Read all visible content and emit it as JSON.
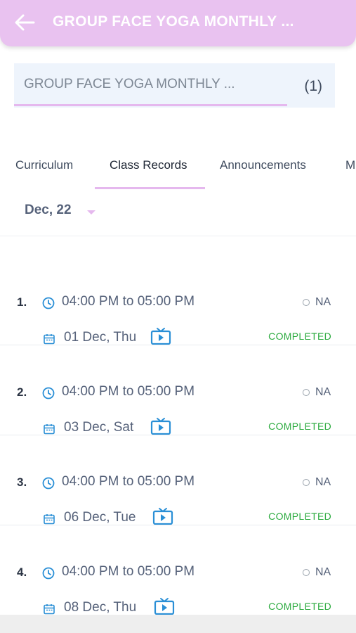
{
  "header": {
    "title": "GROUP FACE YOGA MONTHLY ...",
    "back_icon": "arrow-left-icon",
    "background": "#e9c2f0"
  },
  "course": {
    "name": "GROUP FACE YOGA MONTHLY ...",
    "count": "(1)"
  },
  "tabs": [
    {
      "label": "Curriculum",
      "active": false
    },
    {
      "label": "Class Records",
      "active": true
    },
    {
      "label": "Announcements",
      "active": false
    },
    {
      "label": "M",
      "active": false
    }
  ],
  "month_selector": {
    "label": "Dec, 22",
    "icon": "caret-down-icon"
  },
  "records": [
    {
      "number": "1.",
      "time": "04:00 PM to 05:00 PM",
      "na": "NA",
      "date": "01 Dec, Thu",
      "status": "COMPLETED"
    },
    {
      "number": "2.",
      "time": "04:00 PM to 05:00 PM",
      "na": "NA",
      "date": "03 Dec, Sat",
      "status": "COMPLETED"
    },
    {
      "number": "3.",
      "time": "04:00 PM to 05:00 PM",
      "na": "NA",
      "date": "06 Dec, Tue",
      "status": "COMPLETED"
    },
    {
      "number": "4.",
      "time": "04:00 PM to 05:00 PM",
      "na": "NA",
      "date": "08 Dec, Thu",
      "status": "COMPLETED"
    }
  ],
  "colors": {
    "accent": "#e5b8ee",
    "icon_blue": "#2a8fd6",
    "status_green": "#2aaa3d",
    "text": "#56627a"
  }
}
